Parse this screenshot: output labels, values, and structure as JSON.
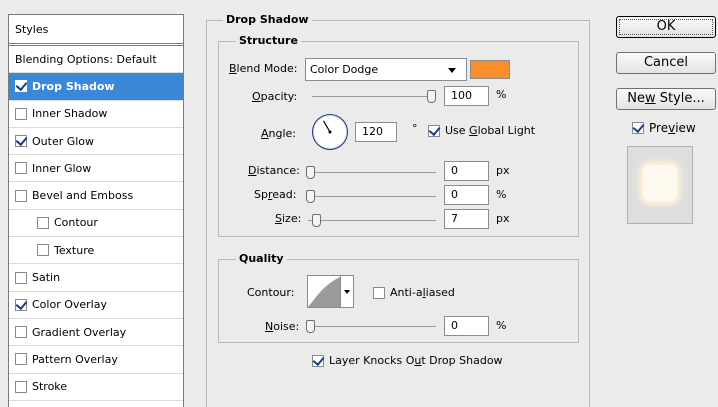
{
  "styles_panel": {
    "header": "Styles",
    "items": [
      {
        "label": "Blending Options: Default",
        "has_checkbox": false,
        "checked": false,
        "selected": false,
        "indent": false
      },
      {
        "label": "Drop Shadow",
        "has_checkbox": true,
        "checked": true,
        "selected": true,
        "indent": false
      },
      {
        "label": "Inner Shadow",
        "has_checkbox": true,
        "checked": false,
        "selected": false,
        "indent": false
      },
      {
        "label": "Outer Glow",
        "has_checkbox": true,
        "checked": true,
        "selected": false,
        "indent": false
      },
      {
        "label": "Inner Glow",
        "has_checkbox": true,
        "checked": false,
        "selected": false,
        "indent": false
      },
      {
        "label": "Bevel and Emboss",
        "has_checkbox": true,
        "checked": false,
        "selected": false,
        "indent": false
      },
      {
        "label": "Contour",
        "has_checkbox": true,
        "checked": false,
        "selected": false,
        "indent": true
      },
      {
        "label": "Texture",
        "has_checkbox": true,
        "checked": false,
        "selected": false,
        "indent": true
      },
      {
        "label": "Satin",
        "has_checkbox": true,
        "checked": false,
        "selected": false,
        "indent": false
      },
      {
        "label": "Color Overlay",
        "has_checkbox": true,
        "checked": true,
        "selected": false,
        "indent": false
      },
      {
        "label": "Gradient Overlay",
        "has_checkbox": true,
        "checked": false,
        "selected": false,
        "indent": false
      },
      {
        "label": "Pattern Overlay",
        "has_checkbox": true,
        "checked": false,
        "selected": false,
        "indent": false
      },
      {
        "label": "Stroke",
        "has_checkbox": true,
        "checked": false,
        "selected": false,
        "indent": false
      }
    ]
  },
  "drop_shadow": {
    "title": "Drop Shadow",
    "structure": {
      "title": "Structure",
      "blend_mode": {
        "label_pre": "",
        "label_u": "B",
        "label_post": "lend Mode:",
        "value": "Color Dodge"
      },
      "color": "#fb8e2c",
      "opacity": {
        "label_u": "O",
        "label_post": "pacity:",
        "value": "100",
        "unit": "%",
        "percent": 100
      },
      "angle": {
        "label_u": "A",
        "label_post": "ngle:",
        "value": "120",
        "unit": "°",
        "degrees": 120
      },
      "global_light": {
        "label_pre": "Use ",
        "label_u": "G",
        "label_post": "lobal Light",
        "checked": true
      },
      "distance": {
        "label_u": "D",
        "label_post": "istance:",
        "value": "0",
        "unit": "px",
        "percent": 0
      },
      "spread": {
        "label_pre": "Sp",
        "label_u": "r",
        "label_post": "ead:",
        "value": "0",
        "unit": "%",
        "percent": 0
      },
      "size": {
        "label_u": "S",
        "label_post": "ize:",
        "value": "7",
        "unit": "px",
        "percent": 5
      }
    },
    "quality": {
      "title": "Quality",
      "contour_label": "Contour:",
      "anti_aliased": {
        "label_pre": "Anti-a",
        "label_u": "l",
        "label_post": "iased",
        "checked": false
      },
      "noise": {
        "label_u": "N",
        "label_post": "oise:",
        "value": "0",
        "unit": "%",
        "percent": 0
      }
    },
    "knockout": {
      "label_pre": "Layer Knocks O",
      "label_u": "u",
      "label_post": "t Drop Shadow",
      "checked": true
    }
  },
  "buttons": {
    "ok": "OK",
    "cancel": "Cancel",
    "new_style": {
      "pre": "Ne",
      "u": "w",
      "post": " Style..."
    },
    "preview": {
      "pre": "Pre",
      "u": "v",
      "post": "iew",
      "checked": true
    }
  }
}
